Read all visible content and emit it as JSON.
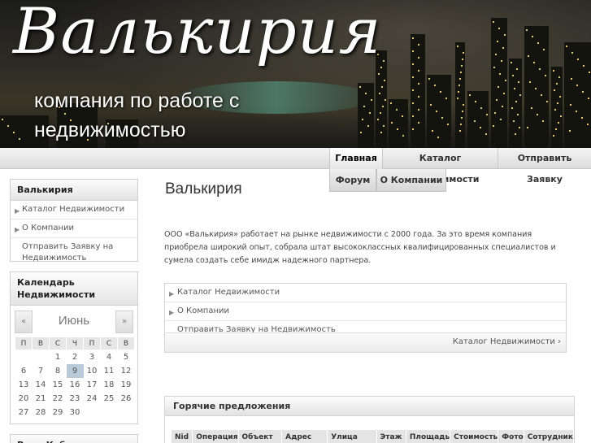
{
  "header": {
    "title": "Валькирия",
    "subtitle": "компания по работе с недвижимостью"
  },
  "nav": {
    "items": [
      "Главная",
      "Каталог Недвижимости",
      "Отправить Заявку"
    ],
    "items2": [
      "Форум",
      "О Компании"
    ]
  },
  "sidebar": {
    "menu_title": "Валькирия",
    "menu_items": [
      "Каталог Недвижимости",
      "О Компании",
      "Отправить Заявку на Недвижимость"
    ],
    "calendar_title": "Календарь Недвижимости",
    "calendar": {
      "prev": "«",
      "next": "»",
      "month": "Июнь",
      "weekdays": [
        "П",
        "В",
        "С",
        "Ч",
        "П",
        "С",
        "В"
      ],
      "weeks": [
        [
          "",
          "",
          "1",
          "2",
          "3",
          "4",
          "5"
        ],
        [
          "6",
          "7",
          "8",
          "9",
          "10",
          "11",
          "12"
        ],
        [
          "13",
          "14",
          "15",
          "16",
          "17",
          "18",
          "19"
        ],
        [
          "20",
          "21",
          "22",
          "23",
          "24",
          "25",
          "26"
        ],
        [
          "27",
          "28",
          "29",
          "30",
          "",
          "",
          ""
        ]
      ],
      "today": "9"
    },
    "third_module_title": "Вход Кабинет"
  },
  "main": {
    "title": "Валькирия",
    "intro": "ООО «Валькирия» работает на рынке недвижимости с 2000 года. За это время компания приобрела широкий опыт, собрала штат высококлассных квалифицированных специалистов и сумела создать себе имидж надежного партнера.",
    "links": [
      "Каталог Недвижимости",
      "О Компании",
      "Отправить Заявку на Недвижимость"
    ],
    "more_link": "Каталог Недвижимости ›",
    "hot_title": "Горячие предложения",
    "hot_columns": [
      "Nid",
      "Операция",
      "Объект",
      "Адрес",
      "Улица",
      "Этаж",
      "Площадь",
      "Стоимость",
      "Фото",
      "Сотрудник"
    ]
  }
}
